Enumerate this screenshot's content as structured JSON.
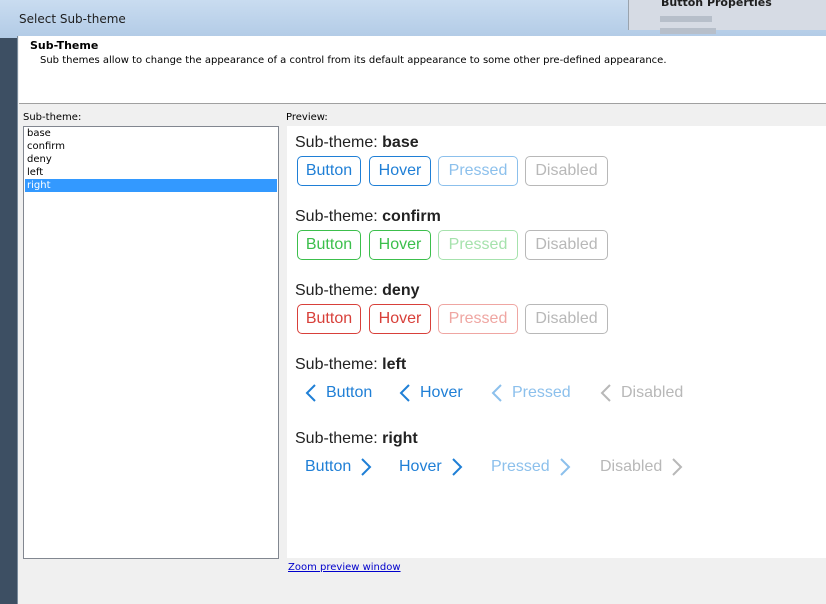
{
  "window": {
    "title": "Select Sub-theme",
    "bg_window_title": "Button Properties"
  },
  "header": {
    "title": "Sub-Theme",
    "description": "Sub themes allow to change the appearance of a control from its default appearance to some other pre-defined appearance."
  },
  "subtheme_label": "Sub-theme:",
  "preview_label": "Preview:",
  "subthemes": [
    "base",
    "confirm",
    "deny",
    "left",
    "right"
  ],
  "selected_subtheme": "right",
  "preview": {
    "title_prefix": "Sub-theme:",
    "states": [
      "Button",
      "Hover",
      "Pressed",
      "Disabled"
    ],
    "groups": [
      {
        "name": "base",
        "colors": [
          "#1f7fd6",
          "#1f7fd6",
          "#8cc0ec",
          "#b8b8b8"
        ]
      },
      {
        "name": "confirm",
        "colors": [
          "#3cbf4c",
          "#3cbf4c",
          "#a6e2ad",
          "#b8b8b8"
        ]
      },
      {
        "name": "deny",
        "colors": [
          "#d8403a",
          "#d8403a",
          "#efa6a2",
          "#b8b8b8"
        ]
      },
      {
        "name": "left",
        "colors": [
          "#1f7fd6",
          "#1f7fd6",
          "#8cc0ec",
          "#b8b8b8"
        ]
      },
      {
        "name": "right",
        "colors": [
          "#1f7fd6",
          "#1f7fd6",
          "#8cc0ec",
          "#b8b8b8"
        ]
      }
    ]
  },
  "zoom_link": "Zoom preview window"
}
